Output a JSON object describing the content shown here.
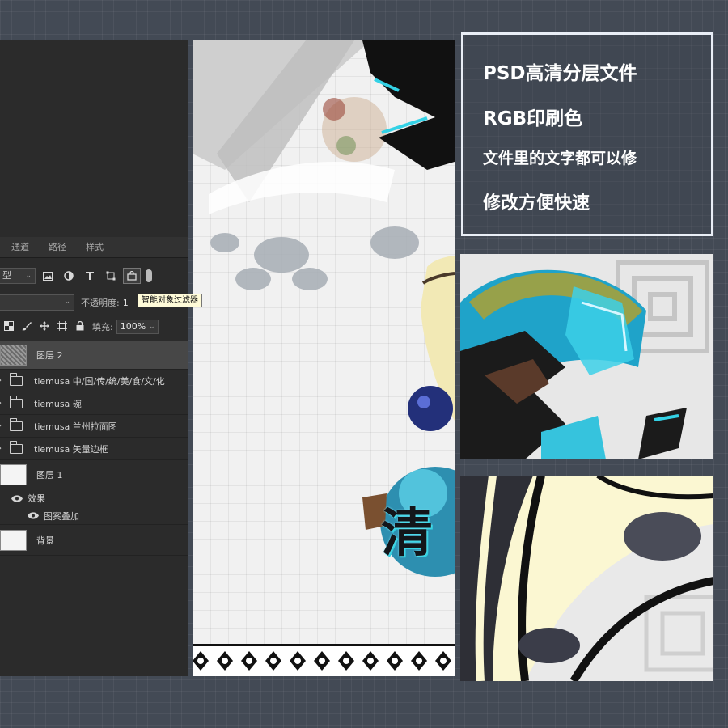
{
  "panel": {
    "tabs": [
      "通道",
      "路径",
      "样式"
    ],
    "filter_type_label": "型",
    "opacity_label": "不透明度:",
    "opacity_value": "1",
    "tooltip": "智能对象过滤器",
    "fill_label": "填充:",
    "fill_value": "100%",
    "layers": {
      "layer2": "图层 2",
      "group1": "tiemusa 中/国/传/统/美/食/文/化",
      "group2": "tiemusa 碗",
      "group3": "tiemusa 兰州拉面图",
      "group4": "tiemusa 矢量边框",
      "layer1": "图层 1",
      "effects_label": "效果",
      "effect_item": "图案叠加",
      "background": "背景"
    }
  },
  "canvas": {
    "glyph": "清"
  },
  "info": {
    "line1": "PSD高清分层文件",
    "line2": "RGB印刷色",
    "line3": "文件里的文字都可以修",
    "line4": "修改方便快速"
  },
  "colors": {
    "background": "#434a55",
    "panel": "#2b2b2b",
    "selected_layer": "#474747",
    "accent_cyan": "#2fd0e0",
    "info_border": "#e9eef6"
  }
}
